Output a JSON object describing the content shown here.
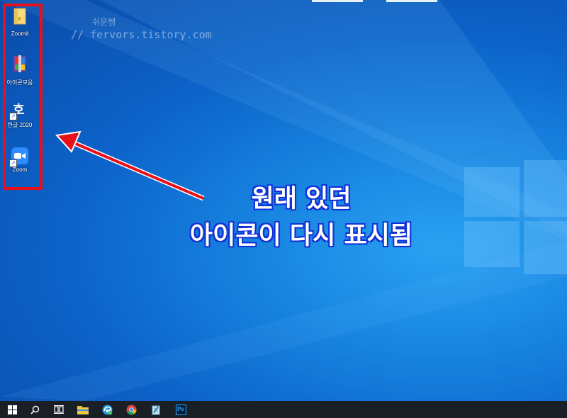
{
  "watermark": {
    "line1": "쉬운쌤",
    "line2": "// fervors.tistory.com"
  },
  "desktop_icons": [
    {
      "label": "Zoomit",
      "icon": "folder-icon"
    },
    {
      "label": "아이콘모음",
      "icon": "winrar-archive-icon"
    },
    {
      "label": "한글 2020",
      "icon": "hangul-app-icon"
    },
    {
      "label": "Zoom",
      "icon": "zoom-app-icon"
    }
  ],
  "callout": {
    "line1": "원래 있던",
    "line2": "아이콘이 다시 표시됨"
  },
  "taskbar": {
    "items": [
      "start-icon",
      "search-icon",
      "task-view-icon",
      "file-explorer-icon",
      "edge-icon",
      "chrome-icon",
      "notepad-icon",
      "photoshop-icon"
    ],
    "photoshop_label": "Ps"
  },
  "colors": {
    "highlight": "#e8101a",
    "callout_outline": "#1232d8",
    "desktop": "#0c63c9",
    "taskbar": "#1a1f26"
  }
}
